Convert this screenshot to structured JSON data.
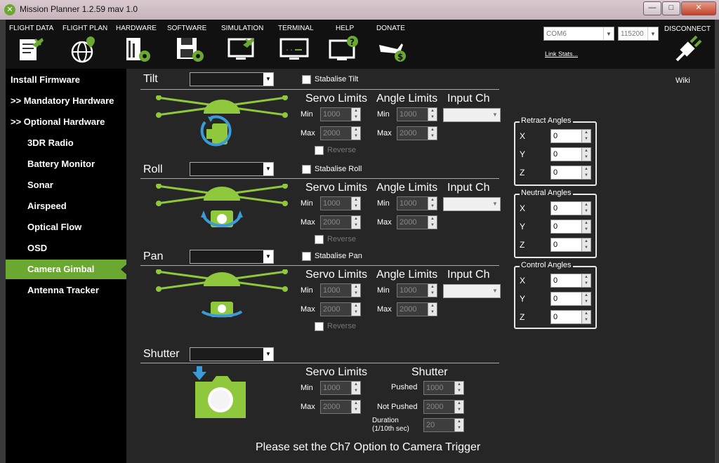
{
  "window": {
    "title": "Mission Planner 1.2.59 mav 1.0",
    "minimize": "—",
    "maximize": "□",
    "close": "✕"
  },
  "toolbar": {
    "items": [
      {
        "label": "FLIGHT DATA",
        "icon": "flight-data-icon"
      },
      {
        "label": "FLIGHT PLAN",
        "icon": "flight-plan-icon"
      },
      {
        "label": "HARDWARE",
        "icon": "hardware-icon"
      },
      {
        "label": "SOFTWARE",
        "icon": "software-icon"
      },
      {
        "label": "SIMULATION",
        "icon": "simulation-icon"
      },
      {
        "label": "TERMINAL",
        "icon": "terminal-icon"
      },
      {
        "label": "HELP",
        "icon": "help-icon"
      },
      {
        "label": "DONATE",
        "icon": "donate-icon"
      }
    ],
    "port": "COM6",
    "baud": "115200",
    "link_stats": "Link Stats...",
    "disconnect": "DISCONNECT"
  },
  "sidebar": {
    "items": [
      {
        "label": "Install Firmware"
      },
      {
        "label": ">> Mandatory Hardware"
      },
      {
        "label": ">> Optional Hardware"
      },
      {
        "label": "3DR Radio"
      },
      {
        "label": "Battery Monitor"
      },
      {
        "label": "Sonar"
      },
      {
        "label": "Airspeed"
      },
      {
        "label": "Optical Flow"
      },
      {
        "label": "OSD"
      },
      {
        "label": "Camera Gimbal",
        "selected": true
      },
      {
        "label": "Antenna Tracker"
      }
    ]
  },
  "gimbal": {
    "wiki": "Wiki",
    "headers": {
      "servo_limits": "Servo Limits",
      "angle_limits": "Angle Limits",
      "input_ch": "Input Ch",
      "min": "Min",
      "max": "Max",
      "reverse": "Reverse"
    },
    "tilt": {
      "label": "Tilt",
      "stabilise": "Stabalise Tilt",
      "servo_min": "1000",
      "servo_max": "2000",
      "angle_min": "1000",
      "angle_max": "2000"
    },
    "roll": {
      "label": "Roll",
      "stabilise": "Stabalise Roll",
      "servo_min": "1000",
      "servo_max": "2000",
      "angle_min": "1000",
      "angle_max": "2000"
    },
    "pan": {
      "label": "Pan",
      "stabilise": "Stabalise Pan",
      "servo_min": "1000",
      "servo_max": "2000",
      "angle_min": "1000",
      "angle_max": "2000"
    },
    "shutter": {
      "label": "Shutter",
      "servo_limits": "Servo Limits",
      "heading": "Shutter",
      "min": "Min",
      "max": "Max",
      "servo_min": "1000",
      "servo_max": "2000",
      "pushed_label": "Pushed",
      "pushed": "1000",
      "not_pushed_label": "Not Pushed",
      "not_pushed": "2000",
      "duration_label": "Duration",
      "duration_unit": "(1/10th sec)",
      "duration": "20"
    },
    "retract": {
      "title": "Retract Angles",
      "x": "0",
      "y": "0",
      "z": "0"
    },
    "neutral": {
      "title": "Neutral Angles",
      "x": "0",
      "y": "0",
      "z": "0"
    },
    "control": {
      "title": "Control Angles",
      "x": "0",
      "y": "0",
      "z": "0"
    },
    "axes": {
      "x": "X",
      "y": "Y",
      "z": "Z"
    },
    "message": "Please set the Ch7 Option to Camera Trigger"
  },
  "colors": {
    "accent": "#6aa832",
    "sidebar_bg": "#000000",
    "panel_bg": "#262626"
  }
}
